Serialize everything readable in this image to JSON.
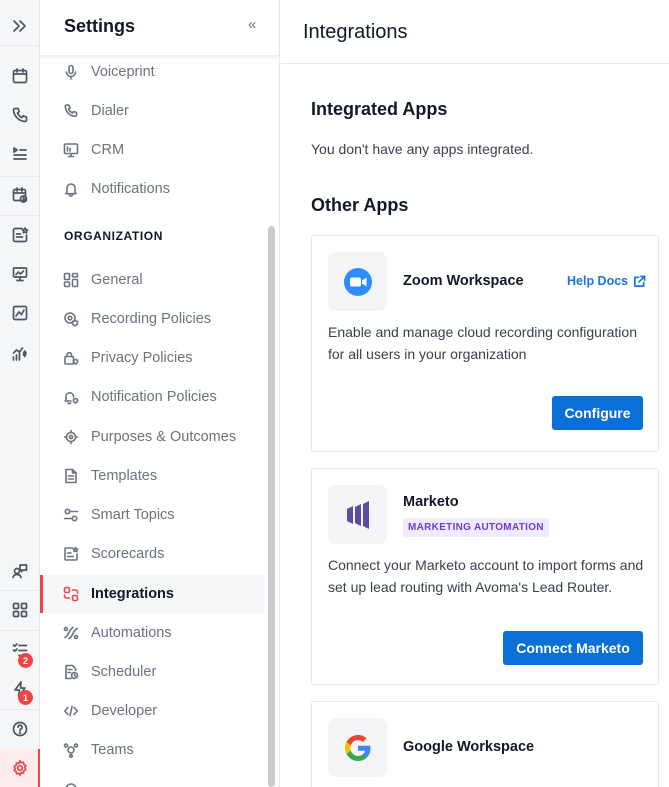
{
  "rail": {
    "notifications_badge": "2",
    "alerts_badge": "1",
    "accent_color": "#ef4444"
  },
  "sidebar": {
    "title": "Settings",
    "collapse_glyph": "«",
    "section_organization": "ORGANIZATION",
    "items": {
      "voiceprint": "Voiceprint",
      "dialer": "Dialer",
      "crm": "CRM",
      "notifications": "Notifications",
      "general": "General",
      "recording_policies": "Recording Policies",
      "privacy_policies": "Privacy Policies",
      "notification_policies": "Notification Policies",
      "purposes_outcomes": "Purposes & Outcomes",
      "templates": "Templates",
      "smart_topics": "Smart Topics",
      "scorecards": "Scorecards",
      "integrations": "Integrations",
      "automations": "Automations",
      "scheduler": "Scheduler",
      "developer": "Developer",
      "teams": "Teams"
    }
  },
  "main": {
    "title": "Integrations",
    "integrated_heading": "Integrated Apps",
    "integrated_empty": "You don't have any apps integrated.",
    "other_heading": "Other Apps",
    "apps": {
      "zoom": {
        "name": "Zoom Workspace",
        "help_label": "Help Docs",
        "description": "Enable and manage cloud recording configuration for all users in your organization",
        "action_label": "Configure"
      },
      "marketo": {
        "name": "Marketo",
        "badge": "MARKETING AUTOMATION",
        "description": "Connect your Marketo account to import forms and set up lead routing with Avoma's Lead Router.",
        "action_label": "Connect Marketo"
      },
      "google": {
        "name": "Google Workspace"
      }
    },
    "primary_color": "#0b6fd8"
  }
}
